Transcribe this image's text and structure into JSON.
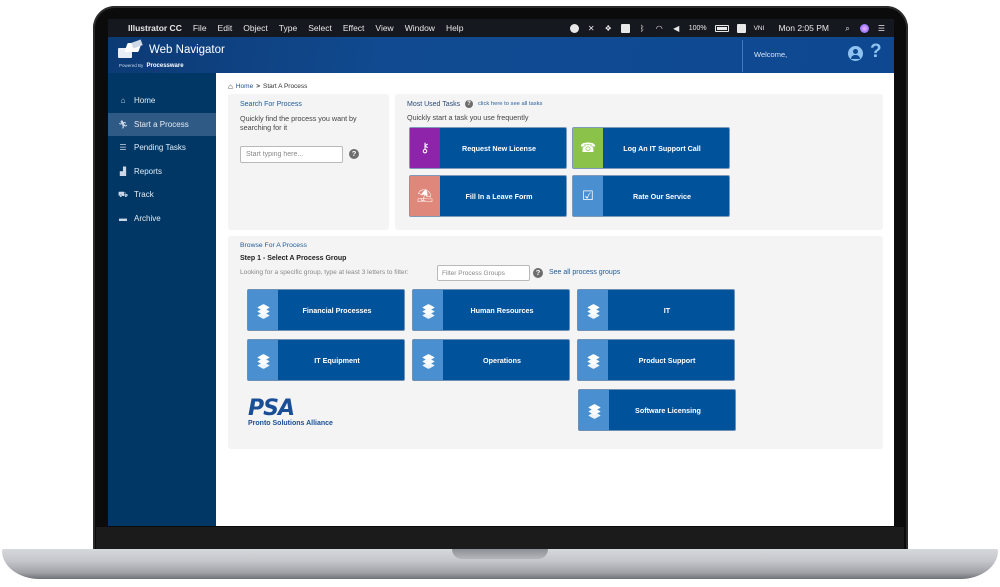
{
  "menubar": {
    "app_name": "Illustrator CC",
    "menus": [
      "File",
      "Edit",
      "Object",
      "Type",
      "Select",
      "Effect",
      "View",
      "Window",
      "Help"
    ],
    "battery": "100%",
    "input_source": "VNI",
    "clock": "Mon 2:05 PM"
  },
  "header": {
    "title": "Web Navigator",
    "powered_by_prefix": "Powered By",
    "powered_by_brand": "Processware",
    "welcome": "Welcome,",
    "help_glyph": "?"
  },
  "sidebar": {
    "items": [
      {
        "label": "Home",
        "icon": "home-icon",
        "active": false
      },
      {
        "label": "Start a Process",
        "icon": "running-icon",
        "active": true
      },
      {
        "label": "Pending Tasks",
        "icon": "list-icon",
        "active": false
      },
      {
        "label": "Reports",
        "icon": "chart-icon",
        "active": false
      },
      {
        "label": "Track",
        "icon": "map-icon",
        "active": false
      },
      {
        "label": "Archive",
        "icon": "archive-icon",
        "active": false
      }
    ]
  },
  "breadcrumb": {
    "home": "Home",
    "separator": ">",
    "current": "Start A Process"
  },
  "search_panel": {
    "title": "Search For Process",
    "description": "Quickly find the process you want by searching for it",
    "input_value": "",
    "input_placeholder": "Start typing here..."
  },
  "most_used": {
    "title": "Most Used Tasks",
    "see_all_link": "click here to see all tasks",
    "description": "Quickly start a task you use frequently",
    "tasks": [
      {
        "label": "Request New License",
        "icon": "key-icon",
        "color": "#8e24aa"
      },
      {
        "label": "Log An IT Support Call",
        "icon": "headset-icon",
        "color": "#8bc34a"
      },
      {
        "label": "Fill In a Leave Form",
        "icon": "beach-icon",
        "color": "#e0877b"
      },
      {
        "label": "Rate Our Service",
        "icon": "checklist-icon",
        "color": "#4a90d0"
      }
    ]
  },
  "browse": {
    "title": "Browse For A Process",
    "step_label": "Step 1 - Select A Process Group",
    "filter_hint": "Looking for a specific group, type at least 3 letters to filter:",
    "filter_value": "",
    "filter_placeholder": "Filter Process Groups",
    "see_all_groups": "See all process groups",
    "groups": [
      {
        "label": "Financial Processes"
      },
      {
        "label": "Human Resources"
      },
      {
        "label": "IT"
      },
      {
        "label": "IT Equipment"
      },
      {
        "label": "Operations"
      },
      {
        "label": "Product Support"
      },
      {
        "label": "Software Licensing"
      }
    ]
  },
  "brand_logo": {
    "mark": "PSA",
    "name": "Pronto Solutions Alliance"
  },
  "colors": {
    "header_blue": "#0f4a92",
    "sidebar_navy": "#003764",
    "sidebar_active": "#2f5a85",
    "tile_blue": "#00529b",
    "tile_icon_blue": "#4a90d0",
    "link_blue": "#1f5a96"
  }
}
